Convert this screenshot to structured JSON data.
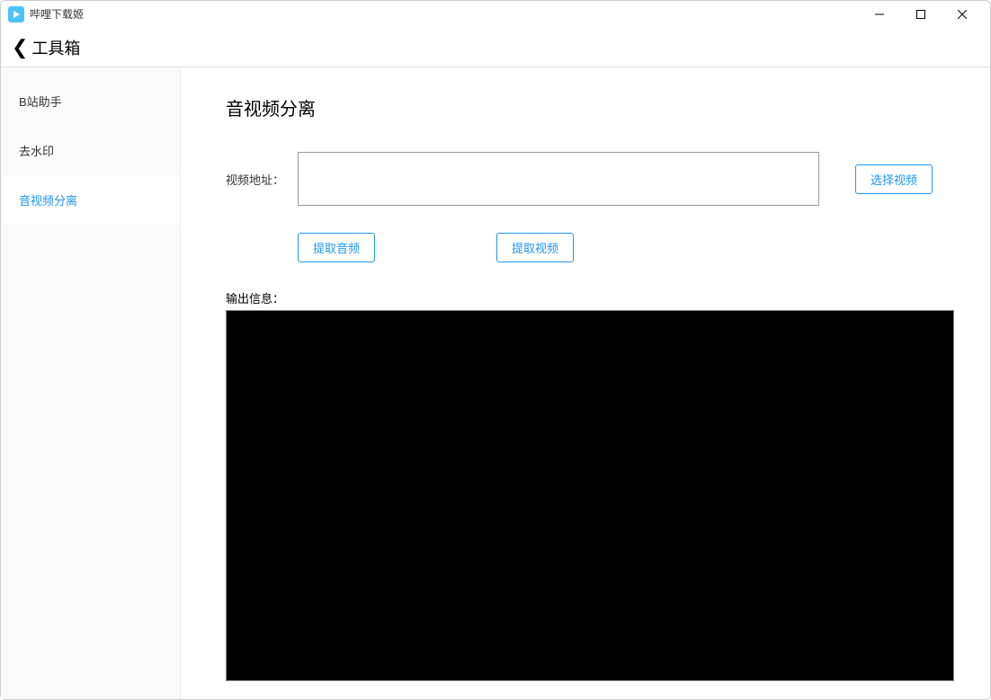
{
  "app": {
    "title": "哔哩下载姬"
  },
  "header": {
    "back_label": "工具箱"
  },
  "sidebar": {
    "items": [
      {
        "label": "B站助手",
        "active": false
      },
      {
        "label": "去水印",
        "active": false
      },
      {
        "label": "音视频分离",
        "active": true
      }
    ]
  },
  "main": {
    "title": "音视频分离",
    "video_url_label": "视频地址：",
    "video_url_value": "",
    "choose_video_label": "选择视频",
    "extract_audio_label": "提取音频",
    "extract_video_label": "提取视频",
    "output_label": "输出信息：",
    "output_content": ""
  }
}
